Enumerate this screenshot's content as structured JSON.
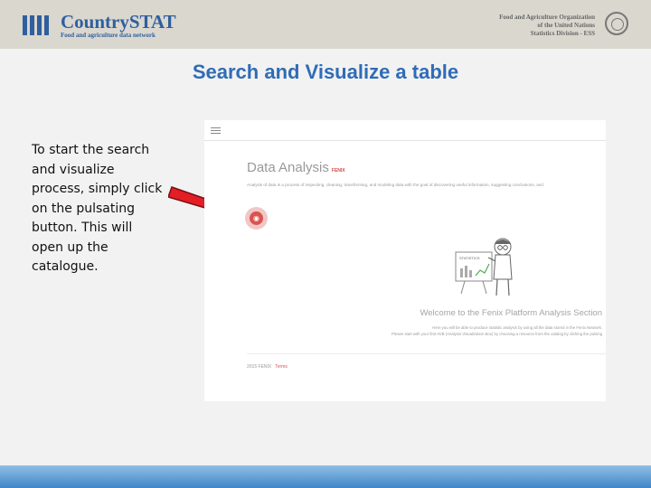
{
  "header": {
    "logo_title": "CountrySTAT",
    "logo_subtitle": "Food and agriculture data network",
    "org_line1": "Food and Agriculture Organization",
    "org_line2": "of the United Nations",
    "org_line3": "Statistics Division - ESS"
  },
  "slide": {
    "title": "Search and Visualize a table",
    "description": "To start the search and visualize process, simply click on the pulsating button. This will open up the catalogue."
  },
  "screenshot": {
    "page_title": "Data Analysis",
    "brand": "FENIX",
    "intro": "Analysis of data is a process of inspecting, cleaning, transforming, and modeling data with the goal of discovering useful information, suggesting conclusions, and",
    "board_label": "STATISTICS",
    "welcome_title": "Welcome to the Fenix Platform Analysis Section",
    "welcome_line1": "Here you will be able to produce statistic analysis by using all the data stored in the Fenix Network.",
    "welcome_line2": "Please start with your first AVB (Analysis Visualization Box) by choosing a resource from the catalog by clicking the pulsing",
    "footer_copy": "2015 FENIX",
    "footer_terms": "Terms"
  },
  "icons": {
    "menu": "hamburger-icon",
    "pulse": "pulse-button-icon",
    "arrow": "red-arrow"
  },
  "colors": {
    "title_blue": "#2f6cb5",
    "brand_blue": "#2f5f9e",
    "accent_red": "#d9534f",
    "arrow_red": "#e31e24"
  }
}
